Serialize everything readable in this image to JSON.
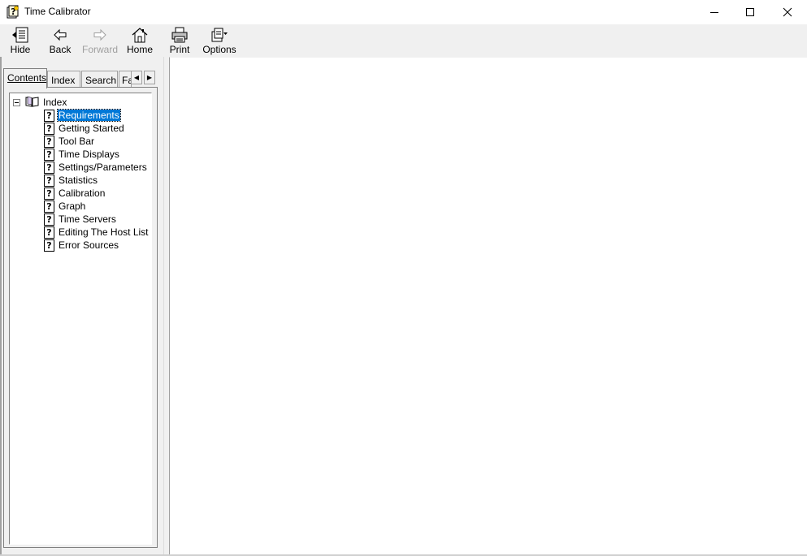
{
  "window": {
    "title": "Time Calibrator",
    "icon": "help-file-icon"
  },
  "toolbar": {
    "hide_label": "Hide",
    "back_label": "Back",
    "forward_label": "Forward",
    "home_label": "Home",
    "print_label": "Print",
    "options_label": "Options"
  },
  "tabs": [
    {
      "label": "Contents"
    },
    {
      "label": "Index"
    },
    {
      "label": "Search"
    },
    {
      "label": "Fa"
    }
  ],
  "tree": {
    "root_label": "Index",
    "items": [
      {
        "label": "Requirements",
        "selected": true
      },
      {
        "label": "Getting Started"
      },
      {
        "label": "Tool Bar"
      },
      {
        "label": "Time Displays"
      },
      {
        "label": "Settings/Parameters"
      },
      {
        "label": "Statistics"
      },
      {
        "label": "Calibration"
      },
      {
        "label": "Graph"
      },
      {
        "label": "Time Servers"
      },
      {
        "label": "Editing The Host List"
      },
      {
        "label": "Error Sources"
      }
    ]
  },
  "colors": {
    "selection": "#0078d7",
    "toolbar_bg": "#f0f0f0",
    "disabled_text": "#a0a0a0"
  }
}
